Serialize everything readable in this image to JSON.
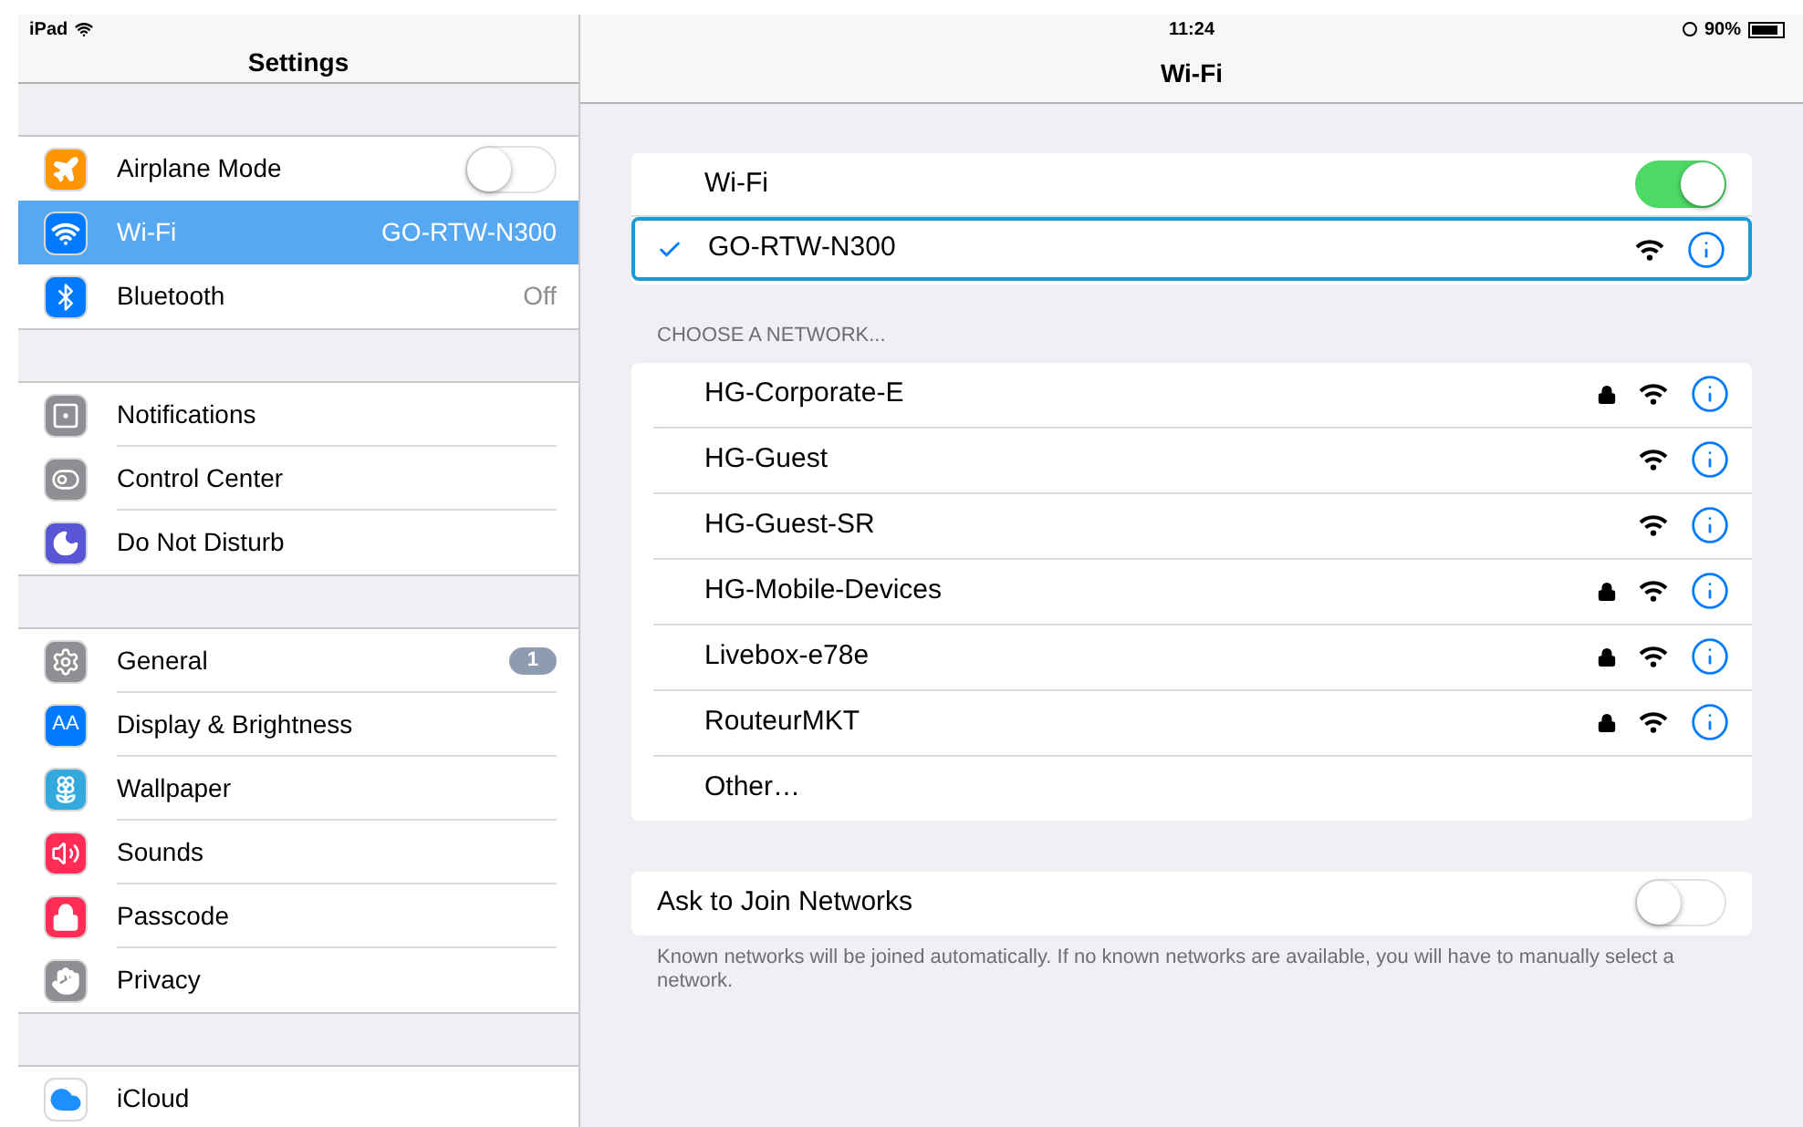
{
  "status_bar": {
    "device": "iPad",
    "time": "11:24",
    "battery": "90%"
  },
  "sidebar": {
    "title": "Settings",
    "groups": [
      [
        {
          "label": "Airplane Mode",
          "color": "#ff9500",
          "kind": "toggle",
          "on": false,
          "selected": false
        },
        {
          "label": "Wi-Fi",
          "color": "#007aff",
          "kind": "value",
          "value": "GO-RTW-N300",
          "selected": true
        },
        {
          "label": "Bluetooth",
          "color": "#007aff",
          "kind": "value",
          "value": "Off",
          "selected": false
        }
      ],
      [
        {
          "label": "Notifications",
          "color": "#8e8e93",
          "kind": "plain",
          "selected": false
        },
        {
          "label": "Control Center",
          "color": "#8e8e93",
          "kind": "plain",
          "selected": false
        },
        {
          "label": "Do Not Disturb",
          "color": "#5856d6",
          "kind": "plain",
          "selected": false
        }
      ],
      [
        {
          "label": "General",
          "color": "#8e8e93",
          "kind": "badge",
          "badge": "1",
          "selected": false
        },
        {
          "label": "Display & Brightness",
          "icon_text": "AA",
          "color": "#007aff",
          "kind": "plain",
          "selected": false
        },
        {
          "label": "Wallpaper",
          "color": "#34aadc",
          "kind": "plain",
          "selected": false
        },
        {
          "label": "Sounds",
          "color": "#ff2d55",
          "kind": "plain",
          "selected": false
        },
        {
          "label": "Passcode",
          "color": "#ff2d55",
          "kind": "plain",
          "selected": false
        },
        {
          "label": "Privacy",
          "color": "#8e8e93",
          "kind": "plain",
          "selected": false
        }
      ],
      [
        {
          "label": "iCloud",
          "color": "#ffffff",
          "kind": "plain",
          "selected": false
        }
      ]
    ]
  },
  "detail": {
    "title": "Wi-Fi",
    "wifi": {
      "label": "Wi-Fi",
      "on": true
    },
    "connected": {
      "name": "GO-RTW-N300",
      "selected": true,
      "highlighted": true
    },
    "section_header": "CHOOSE A NETWORK...",
    "networks": [
      {
        "name": "HG-Corporate-E",
        "locked": true,
        "kind": "network"
      },
      {
        "name": "HG-Guest",
        "locked": false,
        "kind": "network"
      },
      {
        "name": "HG-Guest-SR",
        "locked": false,
        "kind": "network"
      },
      {
        "name": "HG-Mobile-Devices",
        "locked": true,
        "kind": "network"
      },
      {
        "name": "Livebox-e78e",
        "locked": true,
        "kind": "network"
      },
      {
        "name": "RouteurMKT",
        "locked": true,
        "kind": "network"
      },
      {
        "name": "Other…",
        "kind": "other"
      }
    ],
    "ask_to_join": {
      "label": "Ask to Join Networks",
      "on": false
    },
    "footer": "Known networks will be joined automatically. If no known networks are available, you will have to manually select a network."
  }
}
